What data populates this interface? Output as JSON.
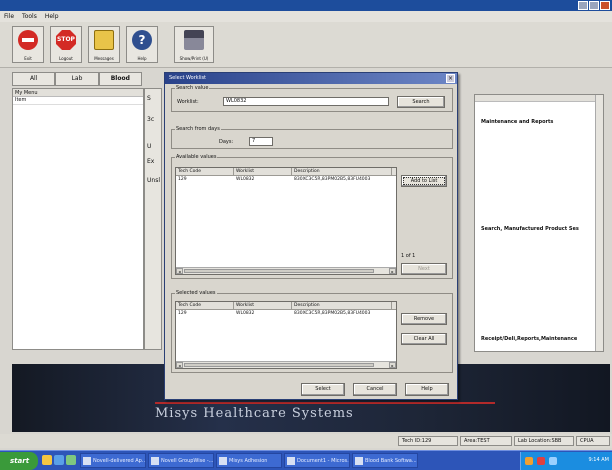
{
  "app": {
    "menus": [
      "File",
      "Tools",
      "Help"
    ],
    "toolbar": [
      {
        "label": "Exit",
        "icon": "exit-icon"
      },
      {
        "label": "Logout",
        "icon": "stop-icon"
      },
      {
        "label": "Messages",
        "icon": "folder-icon"
      },
      {
        "label": "Help",
        "icon": "help-icon"
      },
      {
        "label": "Show/Print (U)",
        "icon": "printer-icon"
      }
    ],
    "tabs": [
      "All",
      "Lab",
      "Blood"
    ],
    "left_header": "My Menu",
    "left_column": "Item",
    "mid_labels": [
      "S",
      "3c",
      "U",
      "Ex",
      "Unsl"
    ],
    "right_labels": [
      "Maintenance and Reports",
      "Search, Manufactured Product Ses",
      "Receipt/Deli,Reports,Maintenance"
    ],
    "banner": "Misys Healthcare Systems",
    "status": {
      "tech_id": "Tech ID:129",
      "area": "Area:TEST",
      "location": "Lab Location:SBB",
      "extra": "CPUA"
    }
  },
  "dialog": {
    "title": "Select Worklist",
    "search_group": "Search value",
    "worklist_label": "Worklist:",
    "worklist_value": "WL0832",
    "search_button": "Search",
    "days_group": "Search from days",
    "days_label": "Days:",
    "days_value": "7",
    "available_group": "Available values",
    "columns": [
      "Tech Code",
      "Worklist",
      "Description"
    ],
    "available_rows": [
      {
        "tech_code": "129",
        "worklist": "WL0832",
        "description": "830XC3C5R,83PM02B5,83FU4003"
      }
    ],
    "add_to_list_button": "Add to List",
    "page_indicator": "1 of 1",
    "next_button": "Next",
    "selected_group": "Selected values",
    "selected_rows": [
      {
        "tech_code": "129",
        "worklist": "WL0832",
        "description": "830XC3C5R,83PM02B5,83FU4003"
      }
    ],
    "remove_button": "Remove",
    "clear_all_button": "Clear All",
    "select_button": "Select",
    "cancel_button": "Cancel",
    "help_button": "Help"
  },
  "taskbar": {
    "start": "start",
    "tasks": [
      "Novell-delivered Ap...",
      "Novell GroupWise -...",
      "Misys Adhesion",
      "Document1 - Micros...",
      "Blood Bank Softwa..."
    ],
    "clock": "9:14 AM"
  },
  "colors": {
    "titlebar": "#1d4d9c",
    "dialog_title": "#29428a",
    "banner": "#1d2536",
    "taskbar": "#2d55b8"
  }
}
